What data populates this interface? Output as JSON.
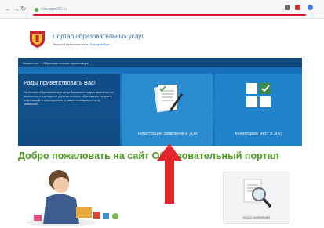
{
  "browser": {
    "back_icon": "back-arrow-icon",
    "forward_icon": "forward-arrow-icon",
    "reload_icon": "reload-icon",
    "url": "edu.egov66.ru",
    "highlight_color": "#d8132b"
  },
  "site": {
    "title": "Портал образовательных услуг",
    "subtitle_prefix": "Текущий муниципалитет:",
    "city": "Екатеринбург",
    "logo_icon": "coat-of-arms-icon"
  },
  "nav": {
    "items": [
      "Заявления",
      "Образовательные организации"
    ],
    "color": "#11497e"
  },
  "banner": {
    "welcome_title": "Рады приветствовать Вас!",
    "welcome_text": "На портале образовательных услуг Вы можете подать заявление на зачисление в учреждение дополнительного образования, получить информацию о мероприятиях, а также отслеживать статус заявлений.",
    "tiles": [
      {
        "label": "Регистрация заявлений в ЗОЛ",
        "icon": "documents-pen-icon"
      },
      {
        "label": "Мониторинг мест в ЗОЛ",
        "icon": "grid-check-icon"
      }
    ]
  },
  "main": {
    "heading": "Добро пожаловать на сайт Образовательный портал",
    "heading_color": "#4a9a1e",
    "search_label": "ПОИСК ЗАЯВЛЕНИЙ",
    "search_icon": "magnifier-document-icon",
    "arrow_color": "#e3252c"
  }
}
